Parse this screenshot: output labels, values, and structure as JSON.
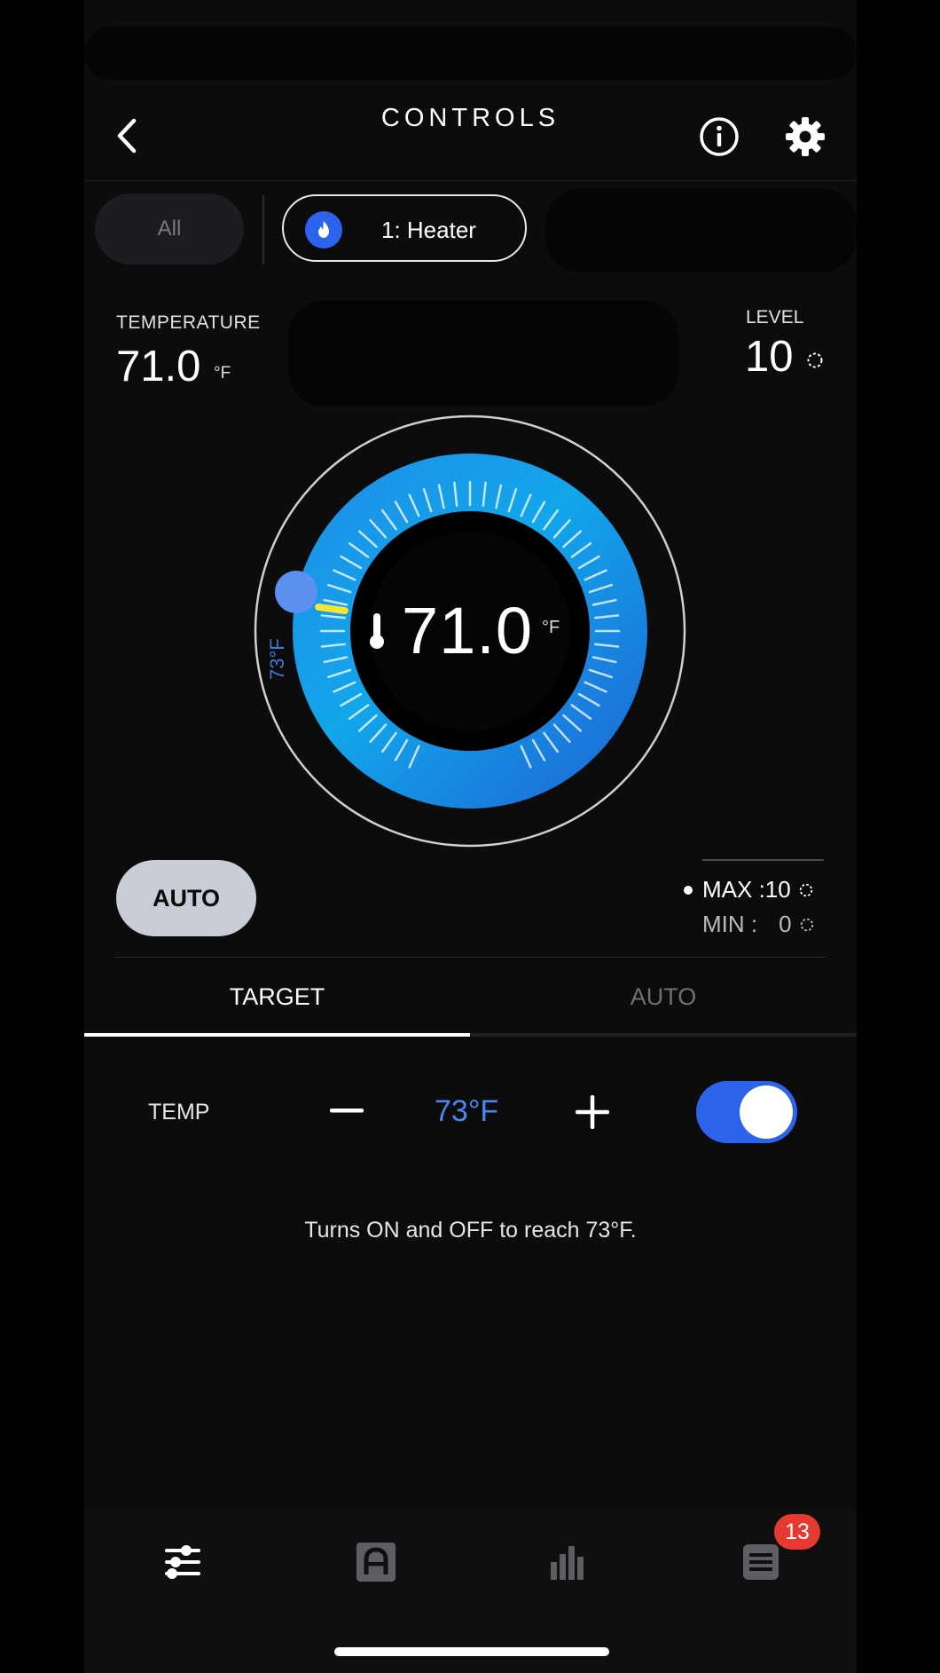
{
  "header": {
    "title": "CONTROLS"
  },
  "chips": {
    "all_label": "All",
    "heater_label": "1: Heater"
  },
  "status": {
    "temperature_label": "TEMPERATURE",
    "temperature_value": "71.0",
    "temperature_unit": "°F",
    "level_label": "LEVEL",
    "level_value": "10"
  },
  "dial": {
    "current_value": "71.0",
    "unit": "°F",
    "target_label": "73°F"
  },
  "mode": {
    "auto_label": "AUTO"
  },
  "limits": {
    "max_label": "MAX :10",
    "min_label": "MIN :",
    "min_value": "0"
  },
  "tabs": {
    "target_label": "TARGET",
    "auto_label": "AUTO",
    "selected": "TARGET"
  },
  "target_control": {
    "label": "TEMP",
    "value": "73°F",
    "enabled": true
  },
  "description": "Turns ON and OFF to reach 73°F.",
  "bottom_nav": {
    "items": [
      "sliders-icon",
      "automation-icon",
      "chart-icon",
      "list-icon"
    ],
    "badge_count": "13"
  },
  "colors": {
    "accent": "#2c63ea",
    "setpoint": "#4a86f0",
    "dial_inner": "#0a84e0",
    "badge": "#e6392f"
  }
}
